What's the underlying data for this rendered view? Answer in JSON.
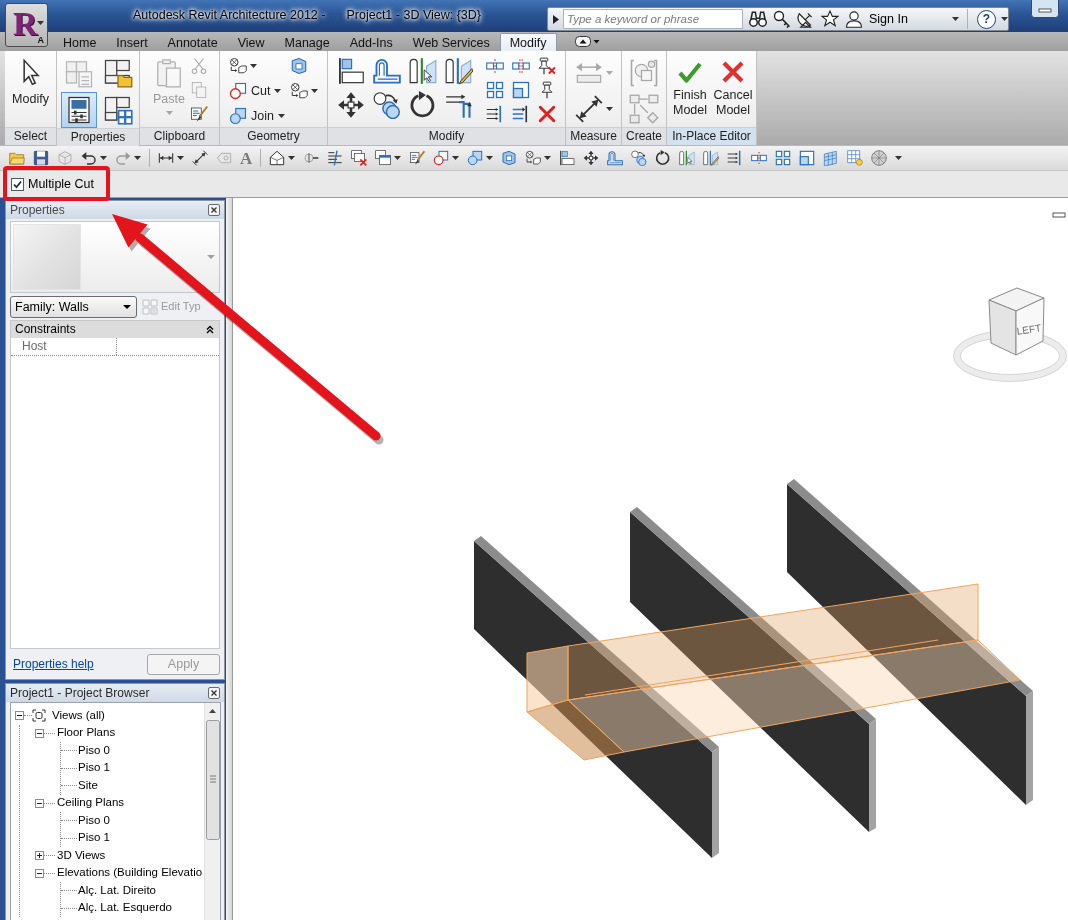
{
  "app_button": {
    "logo": "R",
    "badge": "A"
  },
  "title_bar": {
    "app_title": "Autodesk Revit Architecture 2012 -",
    "document_title": "Project1 - 3D View: {3D}"
  },
  "info_center": {
    "search": {
      "placeholder": "Type a keyword or phrase"
    },
    "sign_in": "Sign In",
    "help": "?"
  },
  "ribbon": {
    "tabs": [
      {
        "label": "Home",
        "selected": false
      },
      {
        "label": "Insert",
        "selected": false
      },
      {
        "label": "Annotate",
        "selected": false
      },
      {
        "label": "View",
        "selected": false
      },
      {
        "label": "Manage",
        "selected": false
      },
      {
        "label": "Add-Ins",
        "selected": false
      },
      {
        "label": "Web Services",
        "selected": false
      },
      {
        "label": "Modify",
        "selected": true
      }
    ],
    "panels": [
      {
        "label": "Select",
        "contextual": false,
        "tools": [
          {
            "label": "Modify"
          }
        ]
      },
      {
        "label": "Properties",
        "contextual": false,
        "tools": [
          {
            "selected": false,
            "disabled": true
          },
          {
            "selected": false,
            "disabled": false
          },
          {
            "selected": true,
            "disabled": false
          },
          {
            "selected": false,
            "disabled": false
          }
        ]
      },
      {
        "label": "Clipboard",
        "contextual": false,
        "tools": [
          {
            "label": "Paste",
            "disabled": true
          },
          {
            "disabled": true
          },
          {
            "disabled": true
          },
          {
            "disabled": false
          }
        ]
      },
      {
        "label": "Geometry",
        "contextual": false,
        "tools": [
          {
            "label": "Cut"
          },
          {
            "label": "Join"
          }
        ]
      },
      {
        "label": "Modify",
        "contextual": false
      },
      {
        "label": "Measure",
        "contextual": false,
        "tools": [
          {
            "disabled": true
          },
          {
            "disabled": false
          }
        ]
      },
      {
        "label": "Create",
        "contextual": false,
        "tools": [
          {
            "disabled": true
          },
          {
            "disabled": true
          }
        ]
      },
      {
        "label": "In-Place Editor",
        "contextual": true,
        "tools": [
          {
            "label": "Finish Model"
          },
          {
            "label": "Cancel Model"
          }
        ]
      }
    ]
  },
  "quick_access_toolbar": {
    "text_glyph": "A"
  },
  "options_bar": {
    "multiple_cut": {
      "label": "Multiple Cut",
      "checked": true
    }
  },
  "properties": {
    "title": "Properties",
    "type_selector": {
      "value": "Family: Walls"
    },
    "edit_type": {
      "label": "Edit Typ",
      "disabled": true
    },
    "groups": [
      {
        "label": "Constraints",
        "expanded": true,
        "rows": [
          {
            "name": "Host"
          }
        ]
      }
    ],
    "help_link": "Properties help",
    "apply": {
      "label": "Apply",
      "disabled": true
    }
  },
  "project_browser": {
    "title": "Project1 - Project Browser",
    "tree": [
      {
        "label": "Views (all)",
        "expanded": true,
        "children": [
          {
            "label": "Floor Plans",
            "expanded": true,
            "children": [
              {
                "label": "Piso 0"
              },
              {
                "label": "Piso 1"
              },
              {
                "label": "Site"
              }
            ]
          },
          {
            "label": "Ceiling Plans",
            "expanded": true,
            "children": [
              {
                "label": "Piso 0"
              },
              {
                "label": "Piso 1"
              }
            ]
          },
          {
            "label": "3D Views",
            "expanded": false
          },
          {
            "label": "Elevations (Building Elevatio",
            "expanded": true,
            "children": [
              {
                "label": "Alç. Lat. Direito"
              },
              {
                "label": "Alç. Lat. Esquerdo"
              }
            ]
          }
        ]
      }
    ]
  },
  "view": {
    "view_cube": {
      "face_label": "LEFT"
    }
  }
}
